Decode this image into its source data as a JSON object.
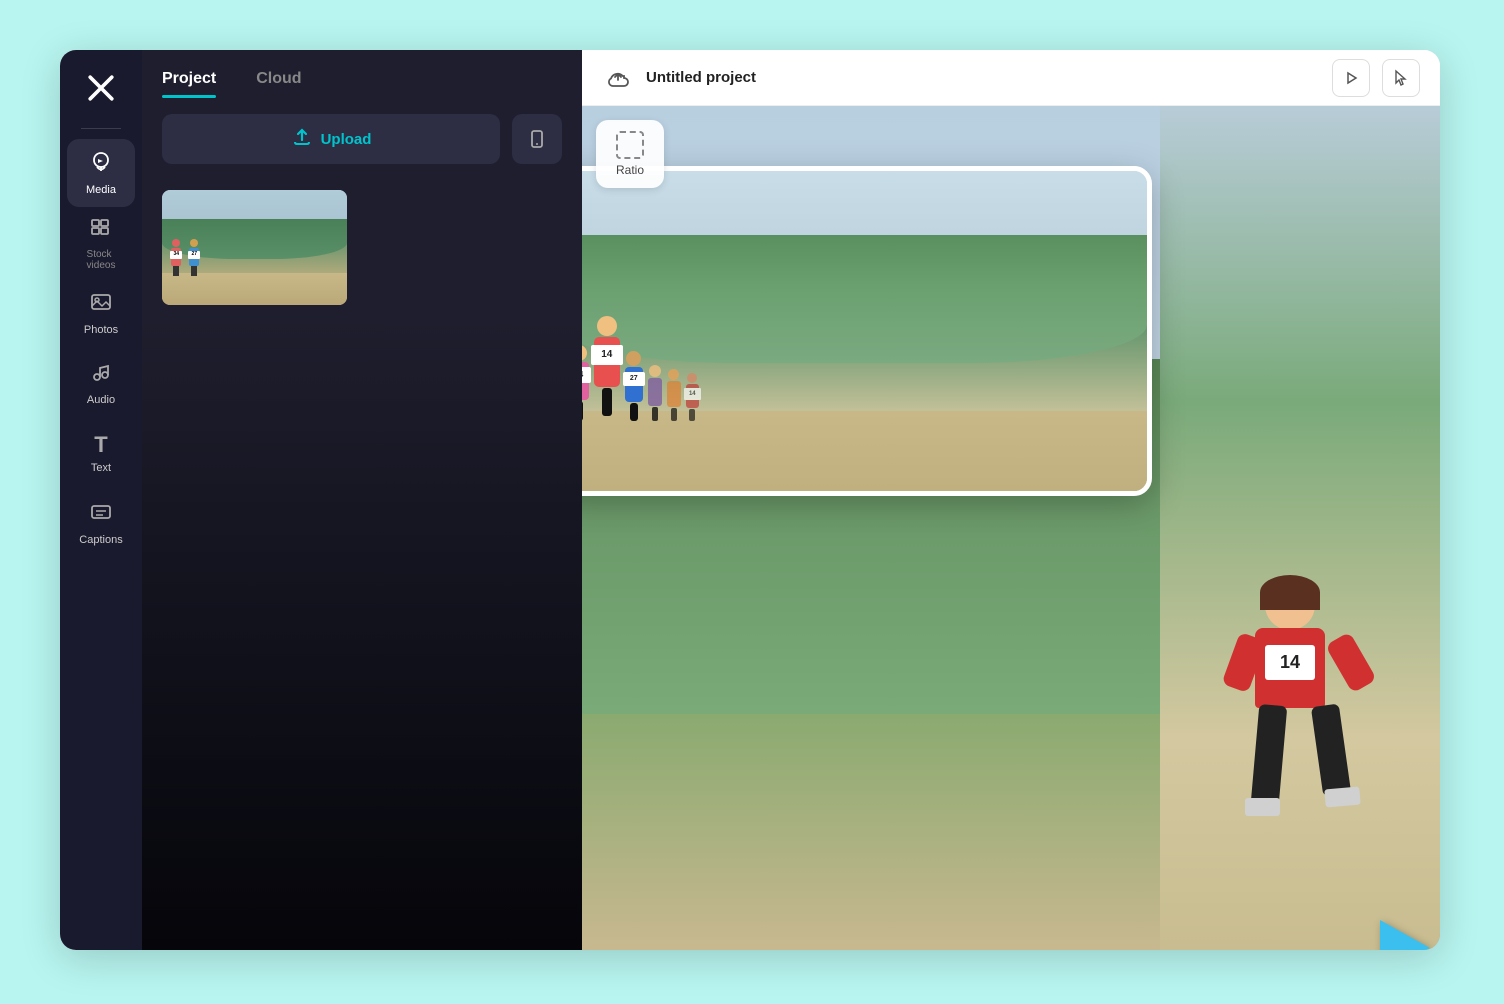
{
  "app": {
    "background_color": "#b8f5f0"
  },
  "sidebar": {
    "logo_alt": "CapCut logo",
    "items": [
      {
        "id": "media",
        "label": "Media",
        "icon": "☁",
        "active": true
      },
      {
        "id": "stock-videos",
        "label": "Stock\nvideos",
        "icon": "▦",
        "active": false
      },
      {
        "id": "photos",
        "label": "Photos",
        "icon": "🖼",
        "active": false
      },
      {
        "id": "audio",
        "label": "Audio",
        "icon": "♫",
        "active": false
      },
      {
        "id": "text",
        "label": "Text",
        "icon": "T",
        "active": false
      },
      {
        "id": "captions",
        "label": "Captions",
        "icon": "☰",
        "active": false
      }
    ]
  },
  "media_panel": {
    "tabs": [
      {
        "id": "project",
        "label": "Project",
        "active": true
      },
      {
        "id": "cloud",
        "label": "Cloud",
        "active": false
      }
    ],
    "upload_button_label": "Upload",
    "mobile_button_icon": "📱",
    "media_items": [
      {
        "id": "clip1",
        "alt": "Runners clip"
      }
    ]
  },
  "preview": {
    "header": {
      "project_title": "Untitled project",
      "cloud_save_icon": "cloud-upload",
      "play_icon": "play",
      "pointer_icon": "pointer"
    },
    "ratio_button": {
      "label": "Ratio",
      "icon": "ratio-grid"
    },
    "canvas": {
      "main_clip_label": "Running race main clip",
      "background_clip_label": "Running race background",
      "runner_bib_numbers": [
        "14",
        "14",
        "34",
        "27"
      ]
    },
    "cursor": {
      "type": "arrow",
      "color": "#3bbfef"
    }
  }
}
